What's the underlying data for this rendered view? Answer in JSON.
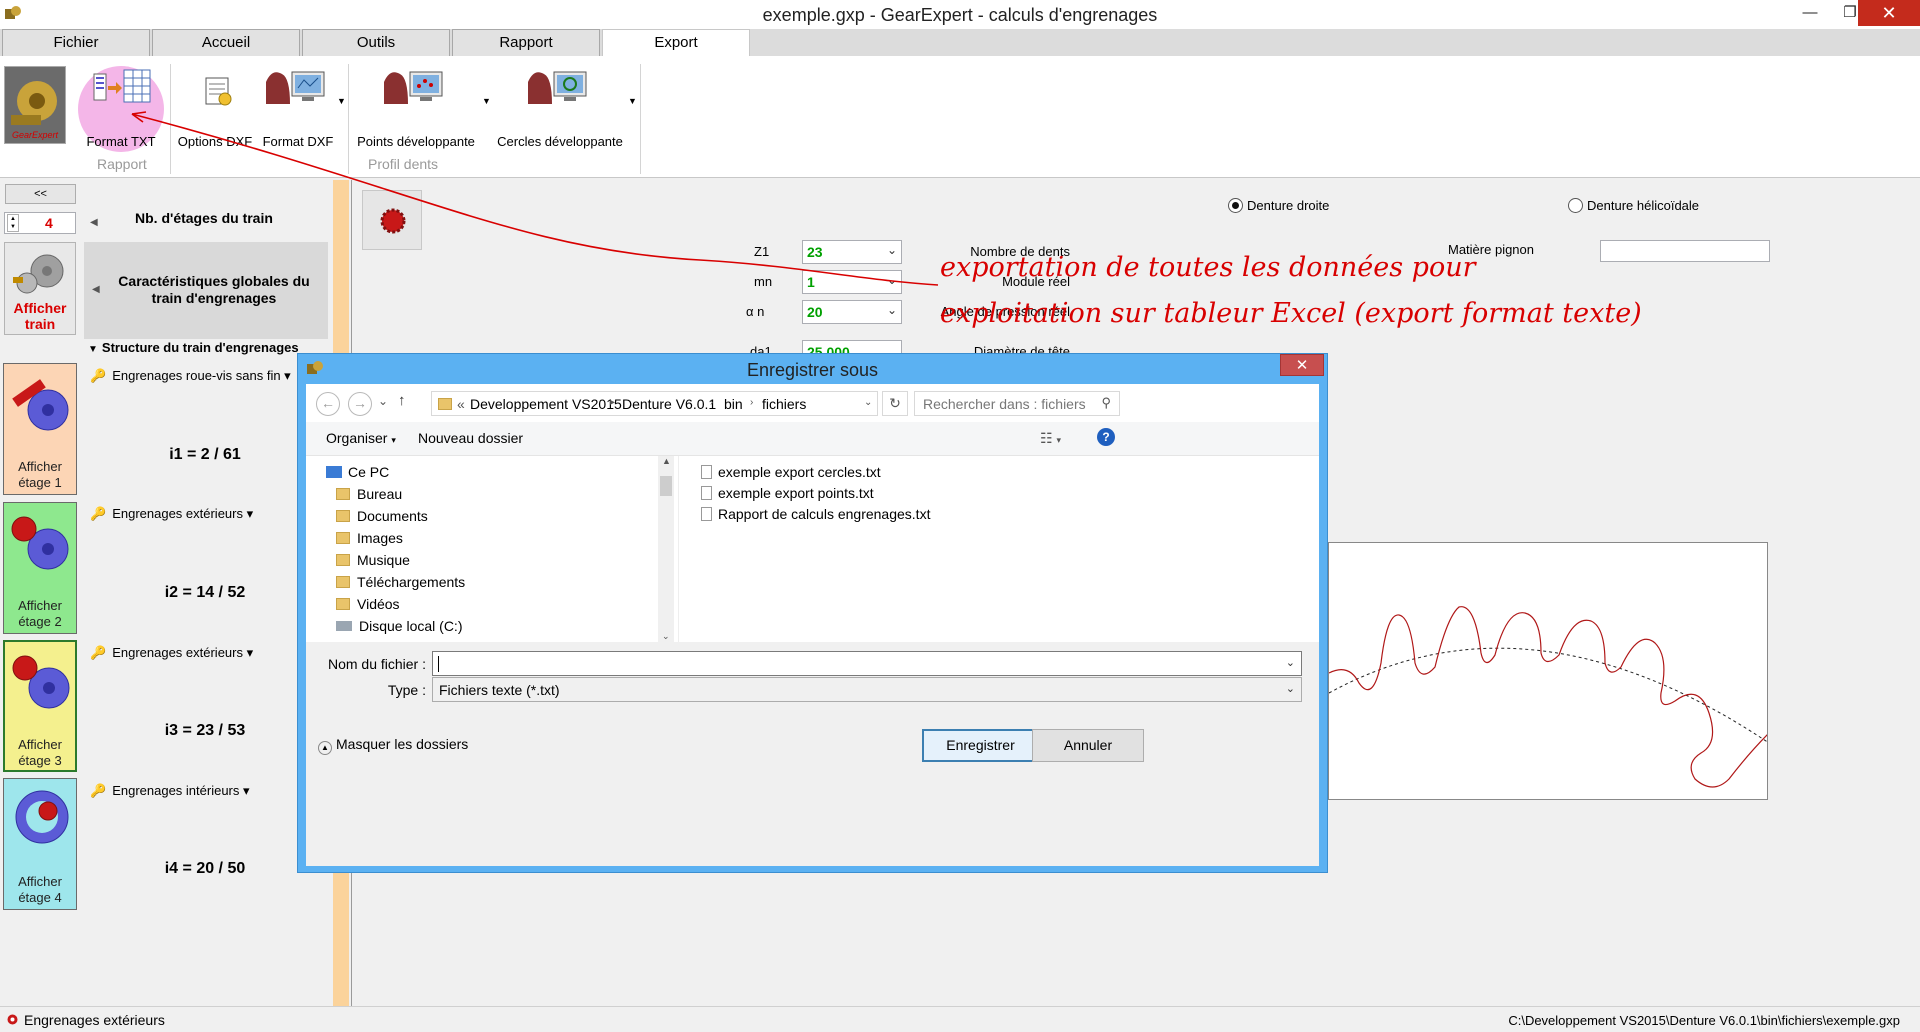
{
  "window": {
    "title": "exemple.gxp - GearExpert - calculs d'engrenages",
    "minimize_label": "—",
    "maximize_label": "❐",
    "close_label": "✕"
  },
  "tabs": [
    "Fichier",
    "Accueil",
    "Outils",
    "Rapport",
    "Export"
  ],
  "active_tab": "Export",
  "ribbon": {
    "buttons": {
      "format_txt": "Format TXT",
      "options_dxf": "Options DXF",
      "format_dxf": "Format DXF",
      "points_dev": "Points développante",
      "cercles_dev": "Cercles développante"
    },
    "groups": {
      "rapport": "Rapport",
      "profil": "Profil dents"
    },
    "logo_text": "GearExpert"
  },
  "left_panel": {
    "collapse_label": "<<",
    "nb_etages_value": "4",
    "nb_etages_label": "Nb. d'étages du train",
    "afficher_train_label": "Afficher train",
    "caracteristiques_label": "Caractéristiques globales du train d'engrenages",
    "structure_label": "Structure du train d'engrenages",
    "stages": [
      {
        "button_label": "Afficher étage 1",
        "type": "Engrenages roue-vis sans fin",
        "ratio": "i1 = 2 / 61",
        "color": "#fcd5b5"
      },
      {
        "button_label": "Afficher étage 2",
        "type": "Engrenages extérieurs",
        "ratio": "i2 = 14 / 52",
        "color": "#8ee88e"
      },
      {
        "button_label": "Afficher étage 3",
        "type": "Engrenages extérieurs",
        "ratio": "i3 = 23 / 53",
        "color": "#f4f08e"
      },
      {
        "button_label": "Afficher étage 4",
        "type": "Engrenages intérieurs",
        "ratio": "i4 = 20 / 50",
        "color": "#9ee6ec"
      }
    ]
  },
  "form": {
    "denture_droite": "Denture droite",
    "denture_helicoidale": "Denture hélicoïdale",
    "matiere_pignon": "Matière pignon",
    "fields": [
      {
        "label": "Nombre de dents",
        "symbol": "Z1",
        "value": "23"
      },
      {
        "label": "Module réel",
        "symbol": "mn",
        "value": "1"
      },
      {
        "label": "Angle de pression réel",
        "symbol": "α n",
        "value": "20"
      },
      {
        "label": "Diamètre de tête",
        "symbol": "da1",
        "value": "25.000"
      }
    ]
  },
  "annotation": {
    "line1": "exportation de toutes les données pour",
    "line2": "exploitation sur tableur Excel   (export format texte)",
    "color": "#d80000"
  },
  "dialog": {
    "title": "Enregistrer sous",
    "close_label": "✕",
    "address": [
      "Developpement VS2015",
      "Denture V6.0.1",
      "bin",
      "fichiers"
    ],
    "address_prefix": "«",
    "search_placeholder": "Rechercher dans : fichiers",
    "organiser": "Organiser",
    "nouveau_dossier": "Nouveau dossier",
    "tree": [
      {
        "label": "Ce PC",
        "icon": "pc-icon"
      },
      {
        "label": "Bureau",
        "icon": "folder-icon"
      },
      {
        "label": "Documents",
        "icon": "folder-icon"
      },
      {
        "label": "Images",
        "icon": "folder-icon"
      },
      {
        "label": "Musique",
        "icon": "folder-icon"
      },
      {
        "label": "Téléchargements",
        "icon": "folder-icon"
      },
      {
        "label": "Vidéos",
        "icon": "folder-icon"
      },
      {
        "label": "Disque local (C:)",
        "icon": "disk-icon"
      }
    ],
    "files": [
      "exemple export cercles.txt",
      "exemple export points.txt",
      "Rapport de calculs engrenages.txt"
    ],
    "filename_label": "Nom du fichier :",
    "filename_value": "",
    "type_label": "Type :",
    "type_value": "Fichiers texte (*.txt)",
    "save_label": "Enregistrer",
    "cancel_label": "Annuler",
    "hide_folders_label": "Masquer les dossiers"
  },
  "statusbar": {
    "left": "Engrenages extérieurs",
    "right": "C:\\Developpement VS2015\\Denture V6.0.1\\bin\\fichiers\\exemple.gxp"
  }
}
